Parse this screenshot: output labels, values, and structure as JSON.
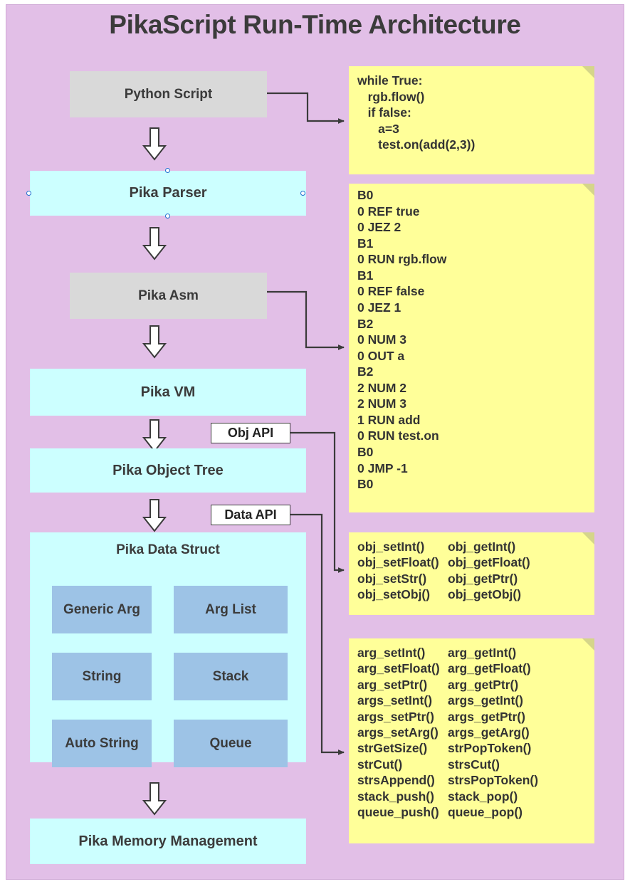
{
  "title": "PikaScript Run-Time Architecture",
  "colors": {
    "background": "#e2bfe7",
    "gray_box": "#d9d9d9",
    "cyan_box": "#ccffff",
    "blue_box": "#9dc3e6",
    "note_box": "#ffff99",
    "note_fold": "#d5d58a",
    "text": "#3b3b3b",
    "connector": "#3b3b3b",
    "handle": "#1f6fd0"
  },
  "flow": {
    "python_script": "Python Script",
    "pika_parser": "Pika Parser",
    "pika_asm": "Pika Asm",
    "pika_vm": "Pika VM",
    "pika_object_tree": "Pika Object Tree",
    "pika_data_struct": "Pika Data Struct",
    "pika_memory_management": "Pika Memory Management"
  },
  "data_struct_items": [
    "Generic Arg",
    "Arg List",
    "String",
    "Stack",
    "Auto String",
    "Queue"
  ],
  "api_tags": {
    "obj_api": "Obj API",
    "data_api": "Data API"
  },
  "notes": {
    "python_code": {
      "lines": [
        "while True:",
        "   rgb.flow()",
        "   if false:",
        "      a=3",
        "      test.on(add(2,3))"
      ]
    },
    "asm_code": {
      "lines": [
        "B0",
        "0 REF true",
        "0 JEZ 2",
        "B1",
        "0 RUN rgb.flow",
        "B1",
        "0 REF false",
        "0 JEZ 1",
        "B2",
        "0 NUM 3",
        "0 OUT a",
        "B2",
        "2 NUM 2",
        "2 NUM 3",
        "1 RUN add",
        "0 RUN test.on",
        "B0",
        "0 JMP -1",
        "B0"
      ]
    },
    "obj_api_functions": {
      "rows": [
        {
          "left": "obj_setInt()",
          "right": "obj_getInt()"
        },
        {
          "left": "obj_setFloat()",
          "right": "obj_getFloat()"
        },
        {
          "left": "obj_setStr()",
          "right": "obj_getPtr()"
        },
        {
          "left": "obj_setObj()",
          "right": "obj_getObj()"
        }
      ]
    },
    "data_api_functions": {
      "rows": [
        {
          "left": "arg_setInt()",
          "right": "arg_getInt()"
        },
        {
          "left": "arg_setFloat()",
          "right": "arg_getFloat()"
        },
        {
          "left": "arg_setPtr()",
          "right": "arg_getPtr()"
        },
        {
          "left": "args_setInt()",
          "right": "args_getInt()"
        },
        {
          "left": "args_setPtr()",
          "right": "args_getPtr()"
        },
        {
          "left": "args_setArg()",
          "right": "args_getArg()"
        },
        {
          "left": "strGetSize()",
          "right": "strPopToken()"
        },
        {
          "left": "strCut()",
          "right": "strsCut()"
        },
        {
          "left": "strsAppend()",
          "right": "strsPopToken()"
        },
        {
          "left": "stack_push()",
          "right": "stack_pop()"
        },
        {
          "left": "queue_push()",
          "right": "queue_pop()"
        }
      ]
    }
  },
  "icons": {
    "down_arrow": "down-arrow-icon",
    "note_fold": "note-fold-corner-icon",
    "connector_arrow": "connector-arrowhead-icon",
    "selection_handle": "selection-handle-icon"
  }
}
